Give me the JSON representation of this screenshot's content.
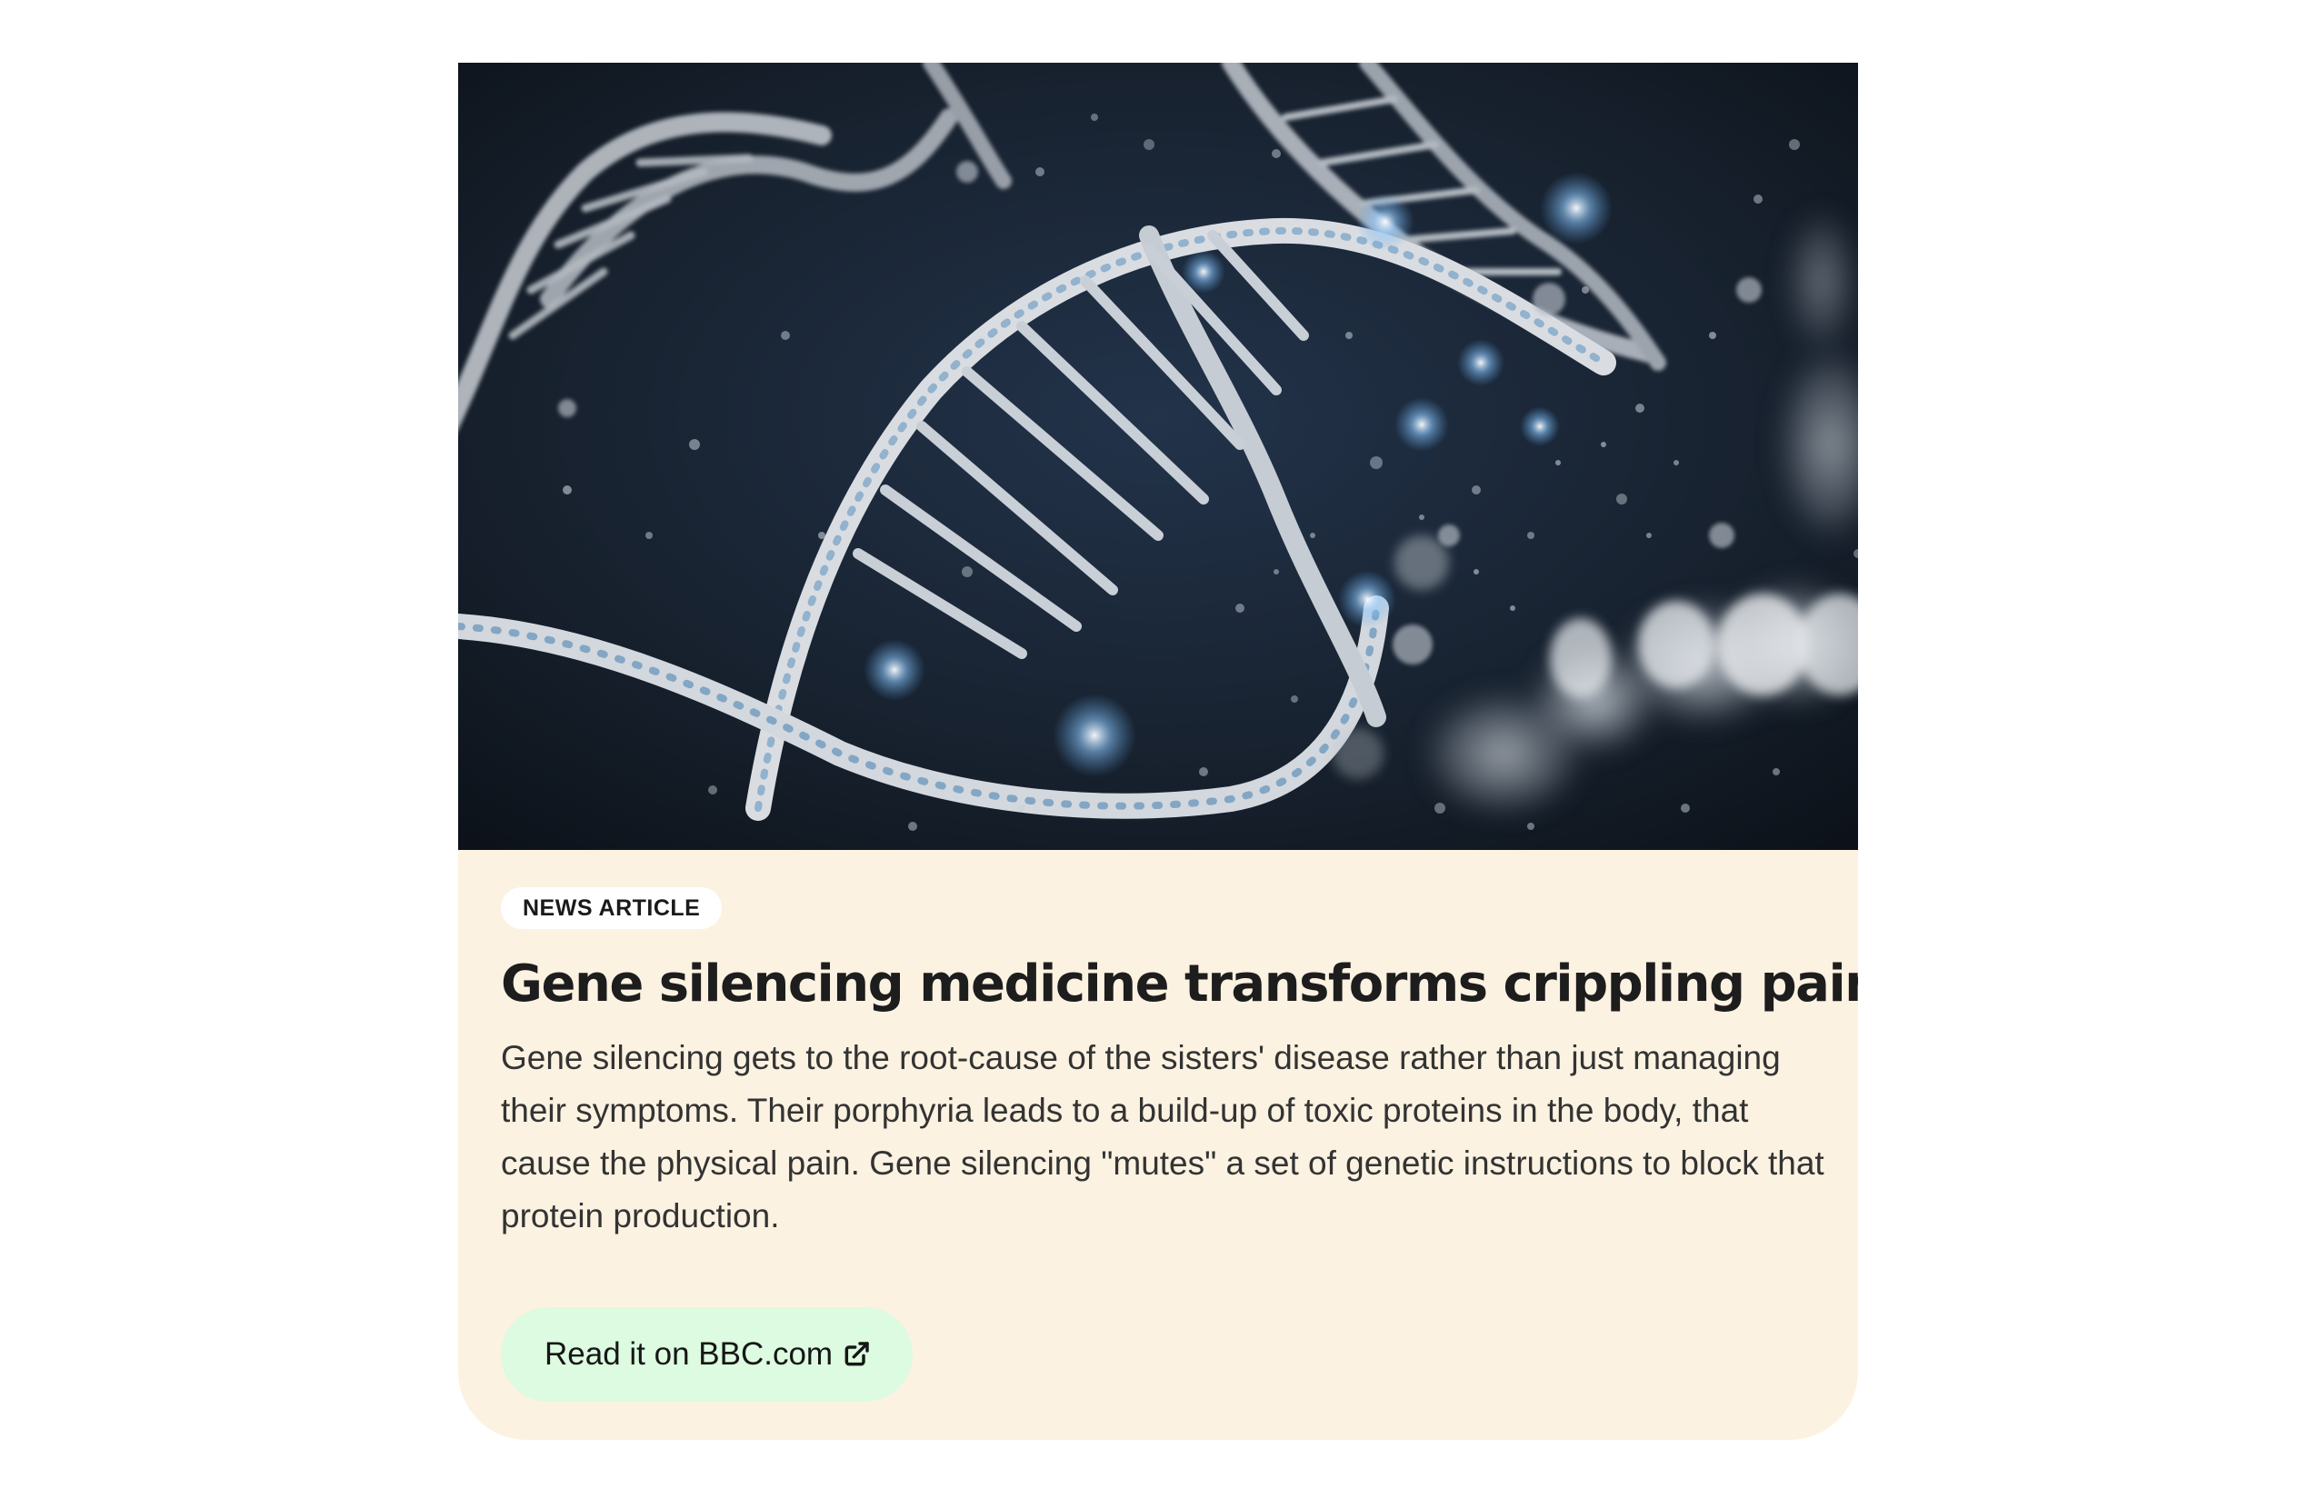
{
  "card": {
    "image_alt": "DNA double helix",
    "badge": "NEWS ARTICLE",
    "title": "Gene silencing medicine transforms crippling pain",
    "description": "Gene silencing gets to the root-cause of the sisters' disease rather than just managing their symptoms. Their porphyria leads to a build-up of toxic proteins in the body, that cause the physical pain. Gene silencing \"mutes\" a set of genetic instructions to block that protein production.",
    "cta_label": "Read it on BBC.com",
    "cta_icon": "external-link-icon"
  },
  "colors": {
    "card_background": "#fcf2e1",
    "badge_background": "#ffffff",
    "cta_background": "#dcfbe0",
    "title_text": "#1d1d1d",
    "body_text": "#333333"
  }
}
